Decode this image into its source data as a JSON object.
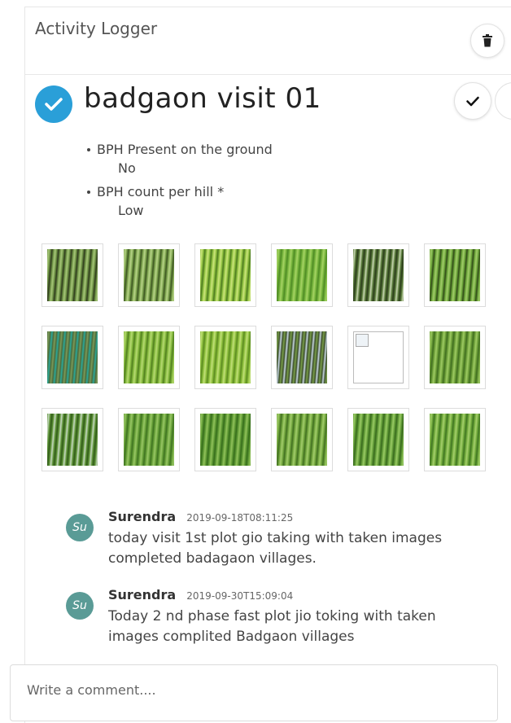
{
  "app": {
    "title": "Activity Logger"
  },
  "toolbar": {
    "delete_icon": "trash-icon"
  },
  "activity": {
    "title": "badgaon visit 01",
    "status_icon": "check-circle-icon",
    "status_color": "#2a9fd8",
    "actions": {
      "mark_done_icon": "checkmark-icon"
    },
    "fields": [
      {
        "label": "BPH Present on the ground",
        "value": "No"
      },
      {
        "label": "BPH count per hill *",
        "value": "Low"
      }
    ],
    "images": [
      {
        "name": "rice-field-photo-1",
        "colors": [
          "#6f9446",
          "#2e3a1c",
          "#a7c779"
        ]
      },
      {
        "name": "rice-field-photo-2",
        "colors": [
          "#7fa650",
          "#3b5520",
          "#b9d589"
        ]
      },
      {
        "name": "rice-field-photo-3",
        "colors": [
          "#93c442",
          "#4b7a1f",
          "#cde57d"
        ]
      },
      {
        "name": "rice-field-photo-4",
        "colors": [
          "#78b63d",
          "#4d8a24",
          "#a7d465"
        ]
      },
      {
        "name": "rice-field-photo-5",
        "colors": [
          "#587a39",
          "#2a3b1b",
          "#c9d7b3"
        ]
      },
      {
        "name": "rice-field-photo-6",
        "colors": [
          "#6ea83b",
          "#304a18",
          "#a3cc6b"
        ]
      },
      {
        "name": "rice-field-photo-7",
        "colors": [
          "#4b6b3c",
          "#2aa99b",
          "#7d9b5a"
        ]
      },
      {
        "name": "rice-field-photo-8",
        "colors": [
          "#86bb3e",
          "#4f7e1e",
          "#b7da73"
        ]
      },
      {
        "name": "rice-field-photo-9",
        "colors": [
          "#8ec03c",
          "#5a8a20",
          "#c2e07a"
        ]
      },
      {
        "name": "rice-field-photo-10",
        "colors": [
          "#3c4f2a",
          "#c7d6e4",
          "#7aa04a"
        ]
      },
      {
        "name": "broken-image",
        "colors": [
          "#ffffff",
          "#ffffff",
          "#ffffff"
        ],
        "broken": true
      },
      {
        "name": "rice-field-photo-12",
        "colors": [
          "#6fa13a",
          "#3f6d1f",
          "#9fcb64"
        ]
      },
      {
        "name": "rice-field-photo-13",
        "colors": [
          "#5e9436",
          "#2f5a19",
          "#c6d8c2"
        ]
      },
      {
        "name": "rice-field-photo-14",
        "colors": [
          "#6aa33a",
          "#3d7220",
          "#99c766"
        ]
      },
      {
        "name": "rice-field-photo-15",
        "colors": [
          "#5f9a34",
          "#356c1b",
          "#92c25c"
        ]
      },
      {
        "name": "rice-field-photo-16",
        "colors": [
          "#74a83f",
          "#406f20",
          "#a3cd6c"
        ]
      },
      {
        "name": "rice-field-photo-17",
        "colors": [
          "#66a03a",
          "#37691d",
          "#9bcb66"
        ]
      },
      {
        "name": "rice-field-photo-18",
        "colors": [
          "#72ab3c",
          "#3e7421",
          "#a6d06d"
        ]
      }
    ]
  },
  "comments": [
    {
      "avatar": "Su",
      "author": "Surendra",
      "time": "2019-09-18T08:11:25",
      "text": "today visit 1st plot gio taking with taken images completed badagaon villages."
    },
    {
      "avatar": "Su",
      "author": "Surendra",
      "time": "2019-09-30T15:09:04",
      "text": "Today 2 nd phase fast plot jio toking with taken images complited Badgaon villages"
    }
  ],
  "comment_input": {
    "placeholder": "Write a comment...."
  }
}
